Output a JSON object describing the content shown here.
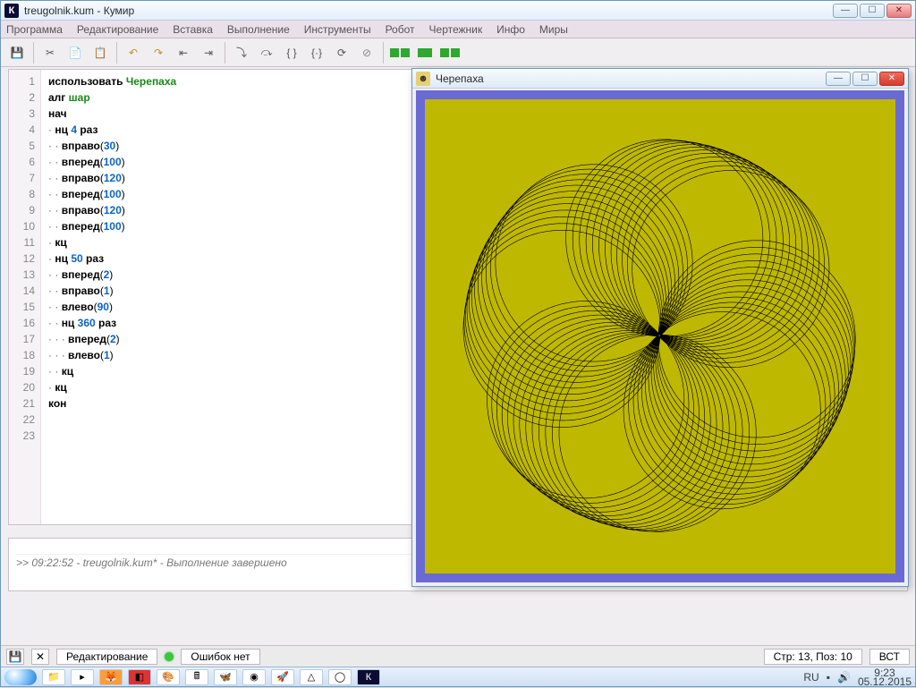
{
  "window": {
    "title": "treugolnik.kum - Кумир"
  },
  "menu": [
    "Программа",
    "Редактирование",
    "Вставка",
    "Выполнение",
    "Инструменты",
    "Робот",
    "Чертежник",
    "Инфо",
    "Миры"
  ],
  "code": {
    "lines": [
      {
        "n": 1,
        "html": "<span class='kw'>использовать</span> <span class='id'>Черепаха</span>"
      },
      {
        "n": 2,
        "html": "<span class='kw'>алг</span> <span class='id'>шар</span>"
      },
      {
        "n": 3,
        "html": "<span class='kw'>нач</span>"
      },
      {
        "n": 4,
        "html": "<span class='dot'>·</span> <span class='kw'>нц</span> <span class='num'>4</span> <span class='kw'>раз</span>"
      },
      {
        "n": 5,
        "html": "<span class='dot'>·</span> <span class='dot'>·</span> <span class='kw'>вправо</span>(<span class='num'>30</span>)"
      },
      {
        "n": 6,
        "html": "<span class='dot'>·</span> <span class='dot'>·</span> <span class='kw'>вперед</span>(<span class='num'>100</span>)"
      },
      {
        "n": 7,
        "html": "<span class='dot'>·</span> <span class='dot'>·</span> <span class='kw'>вправо</span>(<span class='num'>120</span>)"
      },
      {
        "n": 8,
        "html": "<span class='dot'>·</span> <span class='dot'>·</span> <span class='kw'>вперед</span>(<span class='num'>100</span>)"
      },
      {
        "n": 9,
        "html": "<span class='dot'>·</span> <span class='dot'>·</span> <span class='kw'>вправо</span>(<span class='num'>120</span>)"
      },
      {
        "n": 10,
        "html": "<span class='dot'>·</span> <span class='dot'>·</span> <span class='kw'>вперед</span>(<span class='num'>100</span>)"
      },
      {
        "n": 11,
        "html": "<span class='dot'>·</span> <span class='kw'>кц</span>"
      },
      {
        "n": 12,
        "html": "<span class='dot'>·</span> <span class='kw'>нц</span> <span class='num'>50</span> <span class='kw'>раз</span>"
      },
      {
        "n": 13,
        "html": "<span class='dot'>·</span> <span class='dot'>·</span> <span class='kw'>вперед</span>(<span class='num'>2</span>)"
      },
      {
        "n": 14,
        "html": "<span class='dot'>·</span> <span class='dot'>·</span> <span class='kw'>вправо</span>(<span class='num'>1</span>)"
      },
      {
        "n": 15,
        "html": "<span class='dot'>·</span> <span class='dot'>·</span> <span class='kw'>влево</span>(<span class='num'>90</span>)"
      },
      {
        "n": 16,
        "html": "<span class='dot'>·</span> <span class='dot'>·</span> <span class='kw'>нц</span> <span class='num'>360</span> <span class='kw'>раз</span>"
      },
      {
        "n": 17,
        "html": "<span class='dot'>·</span> <span class='dot'>·</span> <span class='dot'>·</span> <span class='kw'>вперед</span>(<span class='num'>2</span>)"
      },
      {
        "n": 18,
        "html": "<span class='dot'>·</span> <span class='dot'>·</span> <span class='dot'>·</span> <span class='kw'>влево</span>(<span class='num'>1</span>)"
      },
      {
        "n": 19,
        "html": "<span class='dot'>·</span> <span class='dot'>·</span> <span class='kw'>кц</span>"
      },
      {
        "n": 20,
        "html": "<span class='dot'>·</span> <span class='kw'>кц</span>"
      },
      {
        "n": 21,
        "html": "<span class='kw'>кон</span>"
      },
      {
        "n": 22,
        "html": ""
      },
      {
        "n": 23,
        "html": ""
      }
    ]
  },
  "console": {
    "line": ">> 09:22:52 - treugolnik.kum* - Выполнение завершено"
  },
  "status": {
    "mode": "Редактирование",
    "errors": "Ошибок нет",
    "pos": "Стр: 13, Поз: 10",
    "ins": "ВСТ"
  },
  "turtle": {
    "title": "Черепаха"
  },
  "tray": {
    "lang": "RU",
    "time": "9:23",
    "date": "05.12.2015"
  },
  "winbtns": {
    "min": "—",
    "max": "☐",
    "close": "✕"
  }
}
